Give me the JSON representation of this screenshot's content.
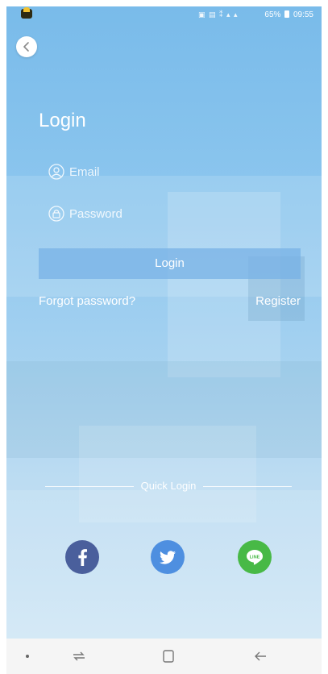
{
  "status_bar": {
    "battery": "65%",
    "time": "09:55"
  },
  "login": {
    "title": "Login",
    "email_placeholder": "Email",
    "password_placeholder": "Password",
    "login_button": "Login",
    "forgot_password": "Forgot password?",
    "register": "Register"
  },
  "quick_login": {
    "label": "Quick Login",
    "providers": [
      "facebook-icon",
      "twitter-icon",
      "line-icon"
    ]
  },
  "colors": {
    "facebook": "#4a5f9c",
    "twitter": "#4e8fe0",
    "line": "#48b946",
    "background_accent": "#79bbea"
  }
}
